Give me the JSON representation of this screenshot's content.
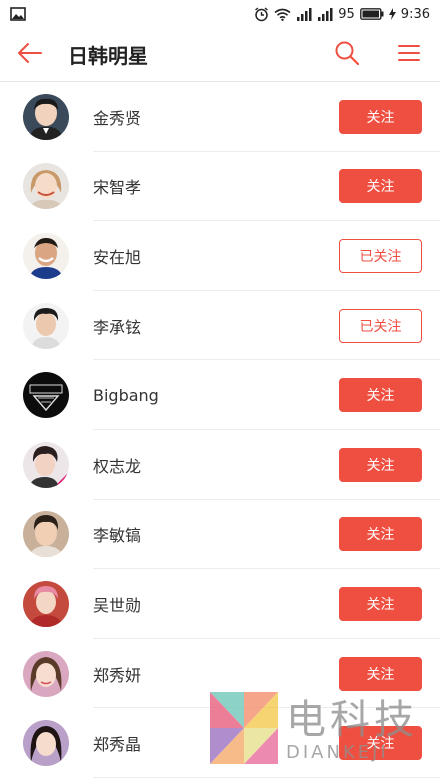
{
  "status_bar": {
    "battery": "95",
    "time": "9:36"
  },
  "header": {
    "title": "日韩明星"
  },
  "colors": {
    "accent": "#ef4f40",
    "divider": "#ececec"
  },
  "stars": [
    {
      "name": "金秀贤",
      "button": "关注",
      "followed": false
    },
    {
      "name": "宋智孝",
      "button": "关注",
      "followed": false
    },
    {
      "name": "安在旭",
      "button": "已关注",
      "followed": true
    },
    {
      "name": "李承铉",
      "button": "已关注",
      "followed": true
    },
    {
      "name": "Bigbang",
      "button": "关注",
      "followed": false
    },
    {
      "name": "权志龙",
      "button": "关注",
      "followed": false
    },
    {
      "name": "李敏镐",
      "button": "关注",
      "followed": false
    },
    {
      "name": "吴世勋",
      "button": "关注",
      "followed": false
    },
    {
      "name": "郑秀妍",
      "button": "关注",
      "followed": false
    },
    {
      "name": "郑秀晶",
      "button": "关注",
      "followed": false
    }
  ],
  "watermark": {
    "cn": "电科技",
    "en": "DIANKEJI"
  }
}
